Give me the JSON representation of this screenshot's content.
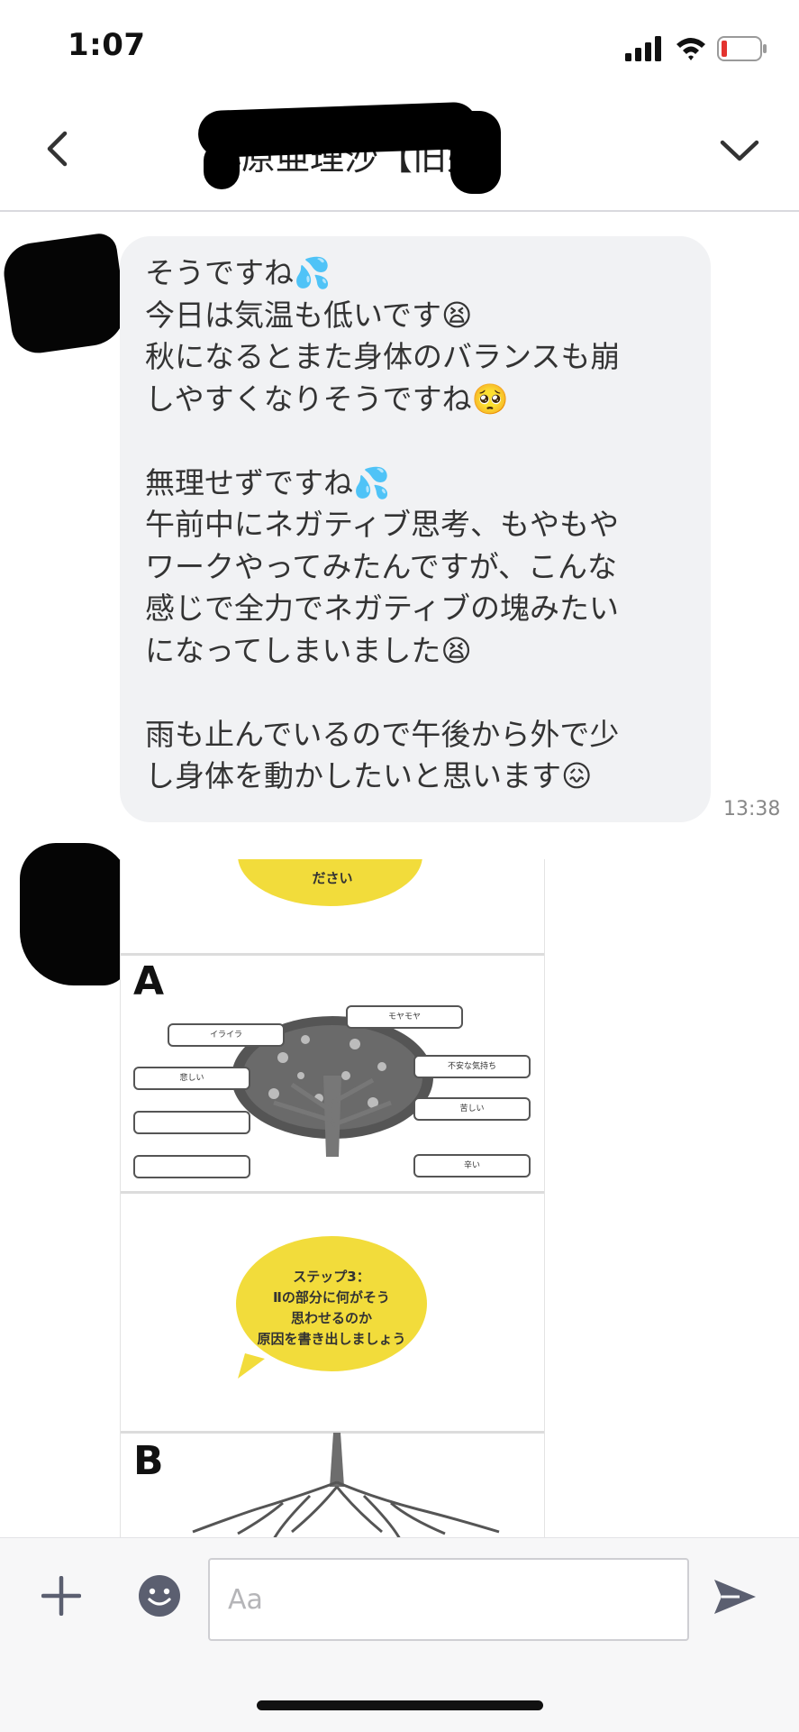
{
  "status_bar": {
    "time": "1:07"
  },
  "header": {
    "title": "小原亜理沙【旧姓】"
  },
  "messages": [
    {
      "type": "text",
      "text": "そうですね💦\n今日は気温も低いです😫\n秋になるとまた身体のバランスも崩\nしやすくなりそうですね🥺\n\n無理せずですね💦\n午前中にネガティブ思考、もやもや\nワークやってみたんですが、こんな\n感じで全力でネガティブの塊みたい\nになってしまいました😫\n\n雨も止んでいるので午後から外で少\nし身体を動かしたいと思います😖",
      "time": "13:38"
    },
    {
      "type": "image",
      "content": {
        "top_bubble_text": "ださい",
        "section_a_label": "A",
        "tree_labels": [
          "イライラ",
          "モヤモヤ",
          "悲しい",
          "不安な気持ち",
          "苦しい",
          "辛い"
        ],
        "step_bubble_lines": [
          "ステップ3：",
          "Ⅱの部分に何がそう",
          "思わせるのか",
          "原因を書き出しましょう"
        ],
        "section_b_label": "B"
      }
    }
  ],
  "input": {
    "placeholder": "Aa"
  },
  "colors": {
    "bubble_bg": "#f1f2f4",
    "icon_gray": "#5b5f70",
    "highlight_yellow": "#f2dc3b",
    "battery_low": "#e3332f"
  }
}
